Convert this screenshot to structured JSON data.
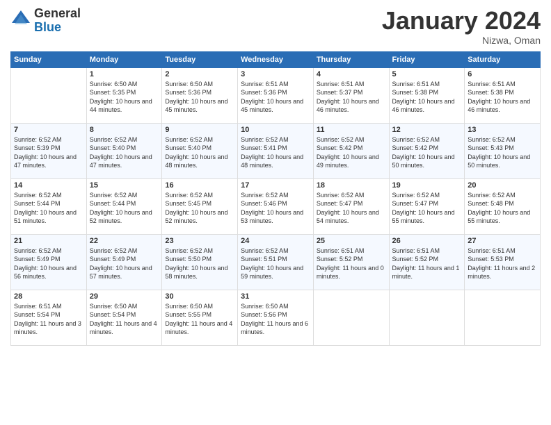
{
  "logo": {
    "general": "General",
    "blue": "Blue"
  },
  "title": "January 2024",
  "location": "Nizwa, Oman",
  "header_days": [
    "Sunday",
    "Monday",
    "Tuesday",
    "Wednesday",
    "Thursday",
    "Friday",
    "Saturday"
  ],
  "weeks": [
    [
      {
        "num": "",
        "sunrise": "",
        "sunset": "",
        "daylight": ""
      },
      {
        "num": "1",
        "sunrise": "Sunrise: 6:50 AM",
        "sunset": "Sunset: 5:35 PM",
        "daylight": "Daylight: 10 hours and 44 minutes."
      },
      {
        "num": "2",
        "sunrise": "Sunrise: 6:50 AM",
        "sunset": "Sunset: 5:36 PM",
        "daylight": "Daylight: 10 hours and 45 minutes."
      },
      {
        "num": "3",
        "sunrise": "Sunrise: 6:51 AM",
        "sunset": "Sunset: 5:36 PM",
        "daylight": "Daylight: 10 hours and 45 minutes."
      },
      {
        "num": "4",
        "sunrise": "Sunrise: 6:51 AM",
        "sunset": "Sunset: 5:37 PM",
        "daylight": "Daylight: 10 hours and 46 minutes."
      },
      {
        "num": "5",
        "sunrise": "Sunrise: 6:51 AM",
        "sunset": "Sunset: 5:38 PM",
        "daylight": "Daylight: 10 hours and 46 minutes."
      },
      {
        "num": "6",
        "sunrise": "Sunrise: 6:51 AM",
        "sunset": "Sunset: 5:38 PM",
        "daylight": "Daylight: 10 hours and 46 minutes."
      }
    ],
    [
      {
        "num": "7",
        "sunrise": "Sunrise: 6:52 AM",
        "sunset": "Sunset: 5:39 PM",
        "daylight": "Daylight: 10 hours and 47 minutes."
      },
      {
        "num": "8",
        "sunrise": "Sunrise: 6:52 AM",
        "sunset": "Sunset: 5:40 PM",
        "daylight": "Daylight: 10 hours and 47 minutes."
      },
      {
        "num": "9",
        "sunrise": "Sunrise: 6:52 AM",
        "sunset": "Sunset: 5:40 PM",
        "daylight": "Daylight: 10 hours and 48 minutes."
      },
      {
        "num": "10",
        "sunrise": "Sunrise: 6:52 AM",
        "sunset": "Sunset: 5:41 PM",
        "daylight": "Daylight: 10 hours and 48 minutes."
      },
      {
        "num": "11",
        "sunrise": "Sunrise: 6:52 AM",
        "sunset": "Sunset: 5:42 PM",
        "daylight": "Daylight: 10 hours and 49 minutes."
      },
      {
        "num": "12",
        "sunrise": "Sunrise: 6:52 AM",
        "sunset": "Sunset: 5:42 PM",
        "daylight": "Daylight: 10 hours and 50 minutes."
      },
      {
        "num": "13",
        "sunrise": "Sunrise: 6:52 AM",
        "sunset": "Sunset: 5:43 PM",
        "daylight": "Daylight: 10 hours and 50 minutes."
      }
    ],
    [
      {
        "num": "14",
        "sunrise": "Sunrise: 6:52 AM",
        "sunset": "Sunset: 5:44 PM",
        "daylight": "Daylight: 10 hours and 51 minutes."
      },
      {
        "num": "15",
        "sunrise": "Sunrise: 6:52 AM",
        "sunset": "Sunset: 5:44 PM",
        "daylight": "Daylight: 10 hours and 52 minutes."
      },
      {
        "num": "16",
        "sunrise": "Sunrise: 6:52 AM",
        "sunset": "Sunset: 5:45 PM",
        "daylight": "Daylight: 10 hours and 52 minutes."
      },
      {
        "num": "17",
        "sunrise": "Sunrise: 6:52 AM",
        "sunset": "Sunset: 5:46 PM",
        "daylight": "Daylight: 10 hours and 53 minutes."
      },
      {
        "num": "18",
        "sunrise": "Sunrise: 6:52 AM",
        "sunset": "Sunset: 5:47 PM",
        "daylight": "Daylight: 10 hours and 54 minutes."
      },
      {
        "num": "19",
        "sunrise": "Sunrise: 6:52 AM",
        "sunset": "Sunset: 5:47 PM",
        "daylight": "Daylight: 10 hours and 55 minutes."
      },
      {
        "num": "20",
        "sunrise": "Sunrise: 6:52 AM",
        "sunset": "Sunset: 5:48 PM",
        "daylight": "Daylight: 10 hours and 55 minutes."
      }
    ],
    [
      {
        "num": "21",
        "sunrise": "Sunrise: 6:52 AM",
        "sunset": "Sunset: 5:49 PM",
        "daylight": "Daylight: 10 hours and 56 minutes."
      },
      {
        "num": "22",
        "sunrise": "Sunrise: 6:52 AM",
        "sunset": "Sunset: 5:49 PM",
        "daylight": "Daylight: 10 hours and 57 minutes."
      },
      {
        "num": "23",
        "sunrise": "Sunrise: 6:52 AM",
        "sunset": "Sunset: 5:50 PM",
        "daylight": "Daylight: 10 hours and 58 minutes."
      },
      {
        "num": "24",
        "sunrise": "Sunrise: 6:52 AM",
        "sunset": "Sunset: 5:51 PM",
        "daylight": "Daylight: 10 hours and 59 minutes."
      },
      {
        "num": "25",
        "sunrise": "Sunrise: 6:51 AM",
        "sunset": "Sunset: 5:52 PM",
        "daylight": "Daylight: 11 hours and 0 minutes."
      },
      {
        "num": "26",
        "sunrise": "Sunrise: 6:51 AM",
        "sunset": "Sunset: 5:52 PM",
        "daylight": "Daylight: 11 hours and 1 minute."
      },
      {
        "num": "27",
        "sunrise": "Sunrise: 6:51 AM",
        "sunset": "Sunset: 5:53 PM",
        "daylight": "Daylight: 11 hours and 2 minutes."
      }
    ],
    [
      {
        "num": "28",
        "sunrise": "Sunrise: 6:51 AM",
        "sunset": "Sunset: 5:54 PM",
        "daylight": "Daylight: 11 hours and 3 minutes."
      },
      {
        "num": "29",
        "sunrise": "Sunrise: 6:50 AM",
        "sunset": "Sunset: 5:54 PM",
        "daylight": "Daylight: 11 hours and 4 minutes."
      },
      {
        "num": "30",
        "sunrise": "Sunrise: 6:50 AM",
        "sunset": "Sunset: 5:55 PM",
        "daylight": "Daylight: 11 hours and 4 minutes."
      },
      {
        "num": "31",
        "sunrise": "Sunrise: 6:50 AM",
        "sunset": "Sunset: 5:56 PM",
        "daylight": "Daylight: 11 hours and 6 minutes."
      },
      {
        "num": "",
        "sunrise": "",
        "sunset": "",
        "daylight": ""
      },
      {
        "num": "",
        "sunrise": "",
        "sunset": "",
        "daylight": ""
      },
      {
        "num": "",
        "sunrise": "",
        "sunset": "",
        "daylight": ""
      }
    ]
  ]
}
